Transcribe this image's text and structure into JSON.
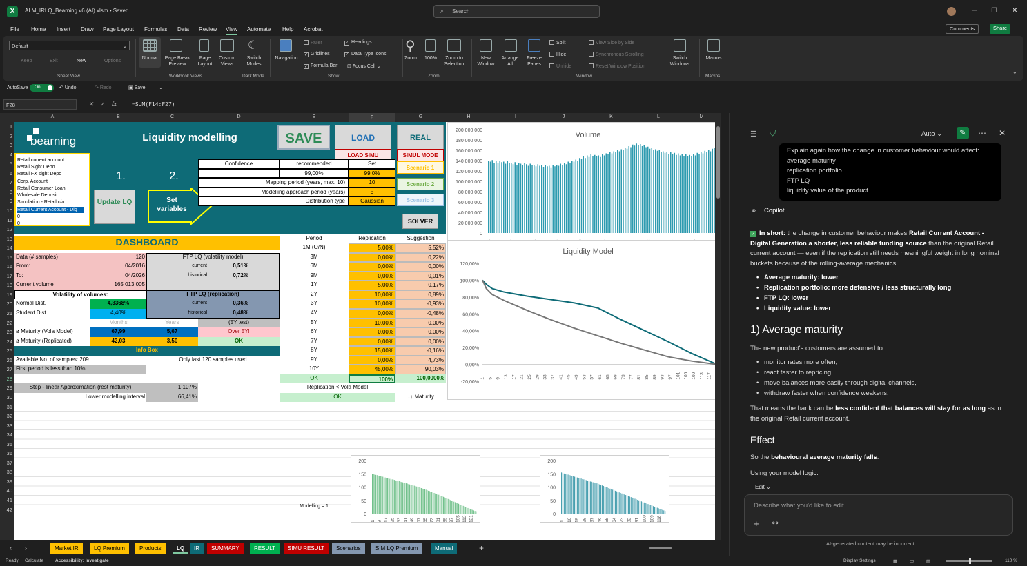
{
  "window": {
    "title": "ALM_IRLQ_Bearning v6 (AI).xlsm • Saved",
    "search_placeholder": "Search"
  },
  "menu": [
    "File",
    "Home",
    "Insert",
    "Draw",
    "Page Layout",
    "Formulas",
    "Data",
    "Review",
    "View",
    "Automate",
    "Help",
    "Acrobat"
  ],
  "menu_active": "View",
  "top_buttons": {
    "comments": "Comments",
    "share": "Share"
  },
  "ribbon": {
    "sheet_view": {
      "dropdown": "Default",
      "keep": "Keep",
      "exit": "Exit",
      "new": "New",
      "options": "Options",
      "group": "Sheet View"
    },
    "workbook_views": {
      "normal": "Normal",
      "page_break": "Page Break Preview",
      "page_layout": "Page Layout",
      "custom": "Custom Views",
      "group": "Workbook Views"
    },
    "dark_mode": {
      "switch": "Switch Modes",
      "group": "Dark Mode"
    },
    "show": {
      "navigation": "Navigation",
      "ruler": "Ruler",
      "gridlines": "Gridlines",
      "formula_bar": "Formula Bar",
      "headings": "Headings",
      "data_type_icons": "Data Type Icons",
      "focus_cell": "Focus Cell",
      "group": "Show"
    },
    "zoom": {
      "zoom": "Zoom",
      "hundred": "100%",
      "zoom_sel": "Zoom to Selection",
      "group": "Zoom"
    },
    "window": {
      "new": "New Window",
      "arrange": "Arrange All",
      "freeze": "Freeze Panes",
      "split": "Split",
      "hide": "Hide",
      "unhide": "Unhide",
      "side": "View Side by Side",
      "sync": "Synchronous Scrolling",
      "reset": "Reset Window Position",
      "switch": "Switch Windows",
      "group": "Window"
    },
    "macros": {
      "macros": "Macros",
      "group": "Macros"
    }
  },
  "qat": {
    "autosave": "AutoSave",
    "on": "On",
    "undo": "Undo",
    "redo": "Redo",
    "save": "Save"
  },
  "formula_bar": {
    "namebox": "F28",
    "fx": "fx",
    "formula": "=SUM(F14:F27)"
  },
  "columns": [
    "A",
    "B",
    "C",
    "D",
    "E",
    "F",
    "G",
    "H",
    "I",
    "J",
    "K",
    "L",
    "M"
  ],
  "rows": [
    "1",
    "2",
    "3",
    "4",
    "5",
    "6",
    "7",
    "8",
    "9",
    "10",
    "11",
    "12",
    "13",
    "14",
    "15",
    "16",
    "17",
    "18",
    "19",
    "20",
    "21",
    "22",
    "23",
    "24",
    "25",
    "26",
    "27",
    "28",
    "29",
    "30",
    "31",
    "32",
    "33",
    "34",
    "35",
    "36",
    "37",
    "38",
    "39",
    "40",
    "41",
    "42"
  ],
  "header": {
    "brand": "bearning",
    "title": "Liquidity modelling",
    "save": "SAVE",
    "load": "LOAD",
    "real": "REAL",
    "load_simu": "LOAD SIMU",
    "simul_mode": "SIMUL MODE",
    "scenario1": "Scenario 1",
    "scenario2": "Scenario 2",
    "scenario3": "Scenario 3",
    "step1": "1.",
    "step2": "2.",
    "update_lq": "Update LQ",
    "set_variables": "Set variables",
    "solver": "SOLVER"
  },
  "product_list": [
    "Retail current account",
    "Retail Sight Depo",
    "Retail FX sight Depo",
    "Corp. Account",
    "Retail Consumer Loan",
    "Wholesale Deposit",
    "Simulation - Retail c/a",
    "Retail Current Account - Dig",
    "0",
    "0"
  ],
  "settings": {
    "head": [
      "Confidence",
      "recommended",
      "Set"
    ],
    "conf_rec": "99,00%",
    "conf_set": "99,0%",
    "rows": [
      {
        "label": "Mapping period (years, max. 10)",
        "value": "10"
      },
      {
        "label": "Modelling approach period (years)",
        "value": "5"
      },
      {
        "label": "Distribution type",
        "value": "Gaussian"
      }
    ]
  },
  "dashboard": {
    "title": "DASHBOARD",
    "data_samples_label": "Data (# samples)",
    "data_samples": "120",
    "from_label": "From:",
    "from": "04/2016",
    "to_label": "To:",
    "to": "04/2026",
    "cur_vol_label": "Current volume",
    "cur_vol": "165 013 005",
    "ftp_vol_title": "FTP LQ (volatility model)",
    "current": "current",
    "historical": "historical",
    "ftp_vol_cur": "0,51%",
    "ftp_vol_hist": "0,72%",
    "vol_title": "Volatility of volumes:",
    "normal_label": "Normal Dist.",
    "normal": "4,3368%",
    "student_label": "Student Dist.",
    "student": "4,40%",
    "ftp_rep_title": "FTP LQ (replication)",
    "ftp_rep_cur": "0,36%",
    "ftp_rep_hist": "0,48%",
    "months": "Months",
    "years": "Years",
    "test5y": "(5Y test)",
    "mat_vola_label": "ø Maturity (Vola Model)",
    "mat_vola_m": "67,99",
    "mat_vola_y": "5,67",
    "over5y": "Over 5Y!",
    "mat_rep_label": "ø Maturity (Replicated)",
    "mat_rep_m": "42,03",
    "mat_rep_y": "3,50",
    "ok": "OK",
    "info_box": "Info Box",
    "avail_samples": "Available No. of samples: 209",
    "only_last": "Only last 120 samples used",
    "first_period": "First period is less than 10%",
    "step_linear": "Step - linear Approximation (rest maturity)",
    "step_linear_val": "1,107%",
    "lower_interval": "Lower modelling interval",
    "lower_interval_val": "66,41%"
  },
  "replication": {
    "head": [
      "Period",
      "Replication",
      "Suggestion"
    ],
    "rows": [
      [
        "1M (O/N)",
        "5,00%",
        "5,52%"
      ],
      [
        "3M",
        "0,00%",
        "0,22%"
      ],
      [
        "6M",
        "0,00%",
        "0,00%"
      ],
      [
        "9M",
        "0,00%",
        "0,01%"
      ],
      [
        "1Y",
        "5,00%",
        "0,17%"
      ],
      [
        "2Y",
        "10,00%",
        "0,89%"
      ],
      [
        "3Y",
        "10,00%",
        "-0,93%"
      ],
      [
        "4Y",
        "0,00%",
        "-0,48%"
      ],
      [
        "5Y",
        "10,00%",
        "0,00%"
      ],
      [
        "6Y",
        "0,00%",
        "0,00%"
      ],
      [
        "7Y",
        "0,00%",
        "0,00%"
      ],
      [
        "8Y",
        "15,00%",
        "-0,16%"
      ],
      [
        "9Y",
        "0,00%",
        "4,73%"
      ],
      [
        "10Y",
        "45,00%",
        "90,03%"
      ]
    ],
    "total": [
      "OK",
      "100%",
      "100,0000%"
    ],
    "note": "Replication < Vola Model",
    "note_ok": "OK",
    "maturity": "↓↓ Maturity",
    "modelling": "Modelling = 1"
  },
  "chart_data": [
    {
      "type": "bar",
      "title": "Volume",
      "ylim": [
        0,
        200000000
      ],
      "y_ticks": [
        "0",
        "20 000 000",
        "40 000 000",
        "60 000 000",
        "80 000 000",
        "100 000 000",
        "120 000 000",
        "140 000 000",
        "160 000 000",
        "180 000 000",
        "200 000 000"
      ],
      "x_ticks": [
        "2016",
        "2017",
        "2018",
        "2019",
        "2020",
        "2021",
        "2022",
        "2023",
        "2024",
        "2025"
      ],
      "values": [
        140000000,
        138000000,
        141000000,
        136000000,
        139000000,
        135000000,
        140000000,
        137000000,
        138000000,
        134000000,
        139000000,
        136000000,
        135000000,
        133000000,
        137000000,
        132000000,
        136000000,
        134000000,
        131000000,
        135000000,
        133000000,
        130000000,
        134000000,
        132000000,
        131000000,
        129000000,
        133000000,
        130000000,
        132000000,
        128000000,
        131000000,
        129000000,
        130000000,
        127000000,
        131000000,
        129000000,
        132000000,
        130000000,
        134000000,
        131000000,
        136000000,
        133000000,
        138000000,
        136000000,
        140000000,
        138000000,
        142000000,
        140000000,
        145000000,
        143000000,
        148000000,
        145000000,
        150000000,
        147000000,
        152000000,
        149000000,
        151000000,
        148000000,
        150000000,
        147000000,
        152000000,
        150000000,
        154000000,
        152000000,
        156000000,
        154000000,
        158000000,
        156000000,
        160000000,
        158000000,
        162000000,
        160000000,
        165000000,
        163000000,
        168000000,
        166000000,
        171000000,
        169000000,
        173000000,
        170000000,
        172000000,
        168000000,
        170000000,
        166000000,
        167000000,
        163000000,
        165000000,
        161000000,
        162000000,
        159000000,
        161000000,
        157000000,
        158000000,
        155000000,
        157000000,
        153000000,
        156000000,
        152000000,
        155000000,
        151000000,
        154000000,
        150000000,
        153000000,
        149000000,
        152000000,
        148000000,
        151000000,
        148000000,
        153000000,
        150000000,
        155000000,
        152000000,
        157000000,
        154000000,
        159000000,
        156000000,
        161000000,
        158000000,
        163000000,
        165000000
      ]
    },
    {
      "type": "line",
      "title": "Liquidity Model",
      "ylim": [
        -0.2,
        1.2
      ],
      "y_ticks": [
        "-20,00%",
        "0,00%",
        "20,00%",
        "40,00%",
        "60,00%",
        "80,00%",
        "100,00%",
        "120,00%"
      ],
      "x_ticks": [
        "1",
        "5",
        "9",
        "13",
        "17",
        "21",
        "25",
        "29",
        "33",
        "37",
        "41",
        "45",
        "49",
        "53",
        "57",
        "61",
        "65",
        "69",
        "73",
        "77",
        "81",
        "85",
        "89",
        "93",
        "97",
        "101",
        "105",
        "109",
        "113",
        "117",
        "121"
      ],
      "series": [
        {
          "color": "#0e6b77",
          "x": [
            1,
            3,
            6,
            12,
            24,
            36,
            48,
            60,
            72,
            84,
            96,
            108,
            121
          ],
          "y": [
            1.0,
            0.95,
            0.9,
            0.86,
            0.81,
            0.77,
            0.73,
            0.67,
            0.53,
            0.4,
            0.27,
            0.13,
            0.0
          ]
        },
        {
          "color": "#777777",
          "x": [
            1,
            3,
            6,
            12,
            24,
            36,
            48,
            60,
            72,
            84,
            96,
            108,
            121
          ],
          "y": [
            1.0,
            0.9,
            0.83,
            0.76,
            0.64,
            0.53,
            0.43,
            0.34,
            0.25,
            0.17,
            0.09,
            0.04,
            0.0
          ]
        }
      ]
    },
    {
      "type": "bar",
      "ylim": [
        0,
        200
      ],
      "y_ticks": [
        "0",
        "50",
        "100",
        "150",
        "200"
      ],
      "x_ticks": [
        "1",
        "9",
        "17",
        "25",
        "33",
        "41",
        "49",
        "57",
        "65",
        "73",
        "81",
        "89",
        "97",
        "105",
        "113",
        "121"
      ],
      "color": "#70c08a",
      "values": [
        150,
        148,
        147,
        146,
        145,
        143,
        142,
        141,
        140,
        139,
        137,
        136,
        135,
        134,
        133,
        131,
        130,
        129,
        128,
        127,
        125,
        124,
        123,
        122,
        120,
        119,
        118,
        117,
        115,
        114,
        113,
        111,
        110,
        109,
        107,
        106,
        105,
        103,
        102,
        100,
        99,
        97,
        96,
        94,
        93,
        91,
        90,
        88,
        86,
        85,
        83,
        81,
        80,
        78,
        76,
        74,
        72,
        71,
        69,
        67,
        65,
        63,
        61,
        59,
        57,
        55,
        53,
        51,
        49,
        47,
        45,
        43,
        41,
        39,
        37,
        35,
        33,
        31,
        29,
        27,
        25,
        23,
        21,
        19,
        17,
        15,
        14,
        12,
        10,
        9
      ]
    },
    {
      "type": "bar",
      "ylim": [
        0,
        200
      ],
      "y_ticks": [
        "0",
        "50",
        "100",
        "150",
        "200"
      ],
      "x_ticks": [
        "1",
        "10",
        "19",
        "28",
        "37",
        "46",
        "55",
        "64",
        "73",
        "82",
        "91",
        "100",
        "109",
        "118"
      ],
      "color": "#4aa0b0",
      "values": [
        155,
        153,
        151,
        150,
        148,
        147,
        145,
        144,
        142,
        141,
        139,
        138,
        136,
        135,
        133,
        132,
        130,
        129,
        127,
        126,
        124,
        123,
        121,
        120,
        118,
        117,
        115,
        114,
        112,
        110,
        108,
        106,
        104,
        102,
        100,
        98,
        96,
        94,
        92,
        90,
        88,
        86,
        84,
        82,
        80,
        78,
        76,
        74,
        72,
        70,
        68,
        66,
        64,
        62,
        60,
        58,
        56,
        54,
        52,
        50,
        48,
        46,
        44,
        42,
        40,
        38,
        36,
        34,
        32,
        30,
        28,
        26,
        24,
        22,
        20,
        18,
        16,
        14,
        12,
        10
      ]
    }
  ],
  "sheet_tabs": [
    {
      "label": "Market IR",
      "color": "#ffc000"
    },
    {
      "label": "LQ Premium",
      "color": "#ffc000"
    },
    {
      "label": "Products",
      "color": "#ffc000"
    },
    {
      "label": "LQ",
      "color": "#ffffff"
    },
    {
      "label": "IR",
      "color": "#0e6b77"
    },
    {
      "label": "SUMMARY",
      "color": "#c00000"
    },
    {
      "label": "RESULT",
      "color": "#00b050"
    },
    {
      "label": "SIMU RESULT",
      "color": "#c00000"
    },
    {
      "label": "Scenarios",
      "color": "#8497b0"
    },
    {
      "label": "SIM LQ Premium",
      "color": "#8497b0"
    },
    {
      "label": "Manual",
      "color": "#0e6b77"
    }
  ],
  "status": {
    "ready": "Ready",
    "calc": "Calculate",
    "access": "Accessibility: Investigate",
    "display": "Display Settings",
    "zoom": "110 %"
  },
  "copilot": {
    "mode": "Auto",
    "user_msg": [
      "Explain again how the change in customer behaviour would affect:",
      "average maturity",
      "replication portfolio",
      "FTP LQ",
      "liquidity value of the product"
    ],
    "name": "Copilot",
    "short_a": "In short:",
    "short_b": "the change in customer behaviour makes",
    "short_c": "Retail Current Account - Digital Generation a shorter, less reliable funding source",
    "short_d": "than the original Retail current account — even if the replication still needs meaningful weight in long nominal buckets because of the rolling-average mechanics.",
    "bullets1": [
      "Average maturity: lower",
      "Replication portfolio: more defensive / less structurally long",
      "FTP LQ: lower",
      "Liquidity value: lower"
    ],
    "h1": "1) Average maturity",
    "p1": "The new product's customers are assumed to:",
    "bullets2": [
      "monitor rates more often,",
      "react faster to repricing,",
      "move balances more easily through digital channels,",
      "withdraw faster when confidence weakens."
    ],
    "p2a": "That means the bank can be",
    "p2b": "less confident that balances will stay for as long",
    "p2c": "as in the original Retail current account.",
    "h2": "Effect",
    "p3a": "So the",
    "p3b": "behavioural average maturity falls",
    "p4": "Using your model logic:",
    "edit": "Edit",
    "input_placeholder": "Describe what you'd like to edit",
    "disclaimer": "AI-generated content may be incorrect"
  }
}
